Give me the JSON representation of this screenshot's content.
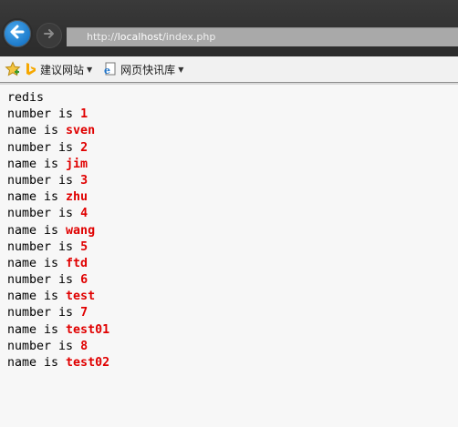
{
  "browser": {
    "url_prefix": "http://",
    "url_host": "localhost",
    "url_path": "/index.php",
    "favorites": [
      {
        "label": "建议网站",
        "icon": "bing-icon"
      },
      {
        "label": "网页快讯库",
        "icon": "ie-page-icon"
      }
    ]
  },
  "page": {
    "heading": "redis",
    "number_label": "number is ",
    "name_label": "name is ",
    "records": [
      {
        "number": "1",
        "name": "sven"
      },
      {
        "number": "2",
        "name": "jim"
      },
      {
        "number": "3",
        "name": "zhu"
      },
      {
        "number": "4",
        "name": "wang"
      },
      {
        "number": "5",
        "name": "ftd"
      },
      {
        "number": "6",
        "name": "test"
      },
      {
        "number": "7",
        "name": "test01"
      },
      {
        "number": "8",
        "name": "test02"
      }
    ]
  },
  "colors": {
    "value": "#e00000",
    "back_button": "#1a78c9"
  }
}
